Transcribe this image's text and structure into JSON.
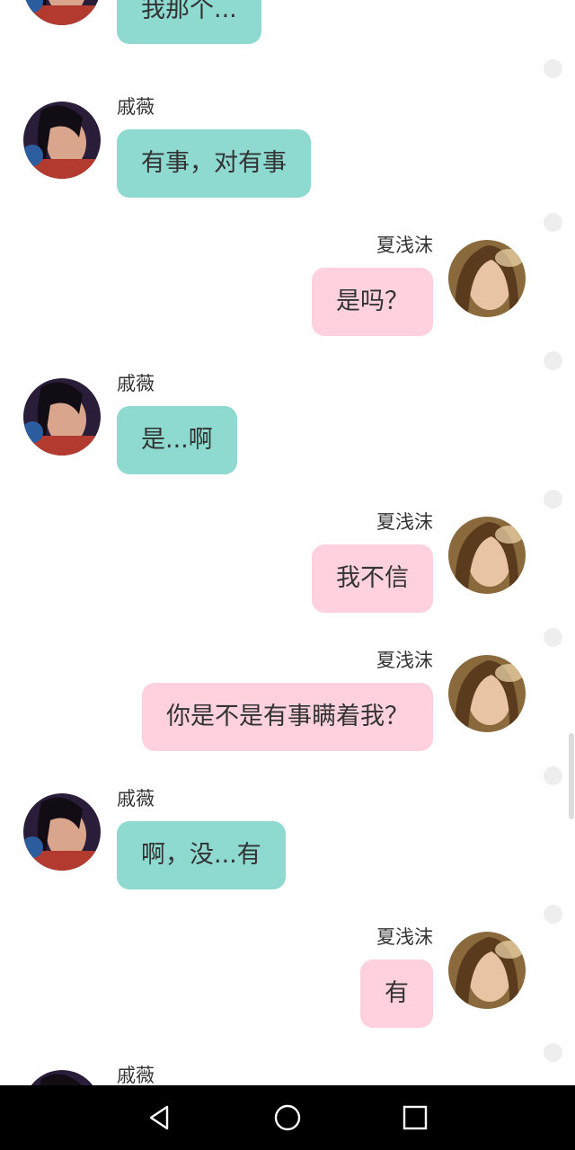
{
  "messages": [
    {
      "side": "left",
      "name": "",
      "text": "我那个..."
    },
    {
      "side": "left",
      "name": "戚薇",
      "text": "有事，对有事"
    },
    {
      "side": "right",
      "name": "夏浅沫",
      "text": "是吗？"
    },
    {
      "side": "left",
      "name": "戚薇",
      "text": "是...啊"
    },
    {
      "side": "right",
      "name": "夏浅沫",
      "text": "我不信"
    },
    {
      "side": "right",
      "name": "夏浅沫",
      "text": "你是不是有事瞒着我？"
    },
    {
      "side": "left",
      "name": "戚薇",
      "text": "啊，没...有"
    },
    {
      "side": "right",
      "name": "夏浅沫",
      "text": "有"
    },
    {
      "side": "left",
      "name": "戚薇",
      "text": ""
    }
  ],
  "colors": {
    "left_bubble": "#8ed9d0",
    "right_bubble": "#ffd1df",
    "nav_bar": "#000000"
  },
  "nav_icons": [
    "back-triangle-icon",
    "home-circle-icon",
    "recents-square-icon"
  ]
}
